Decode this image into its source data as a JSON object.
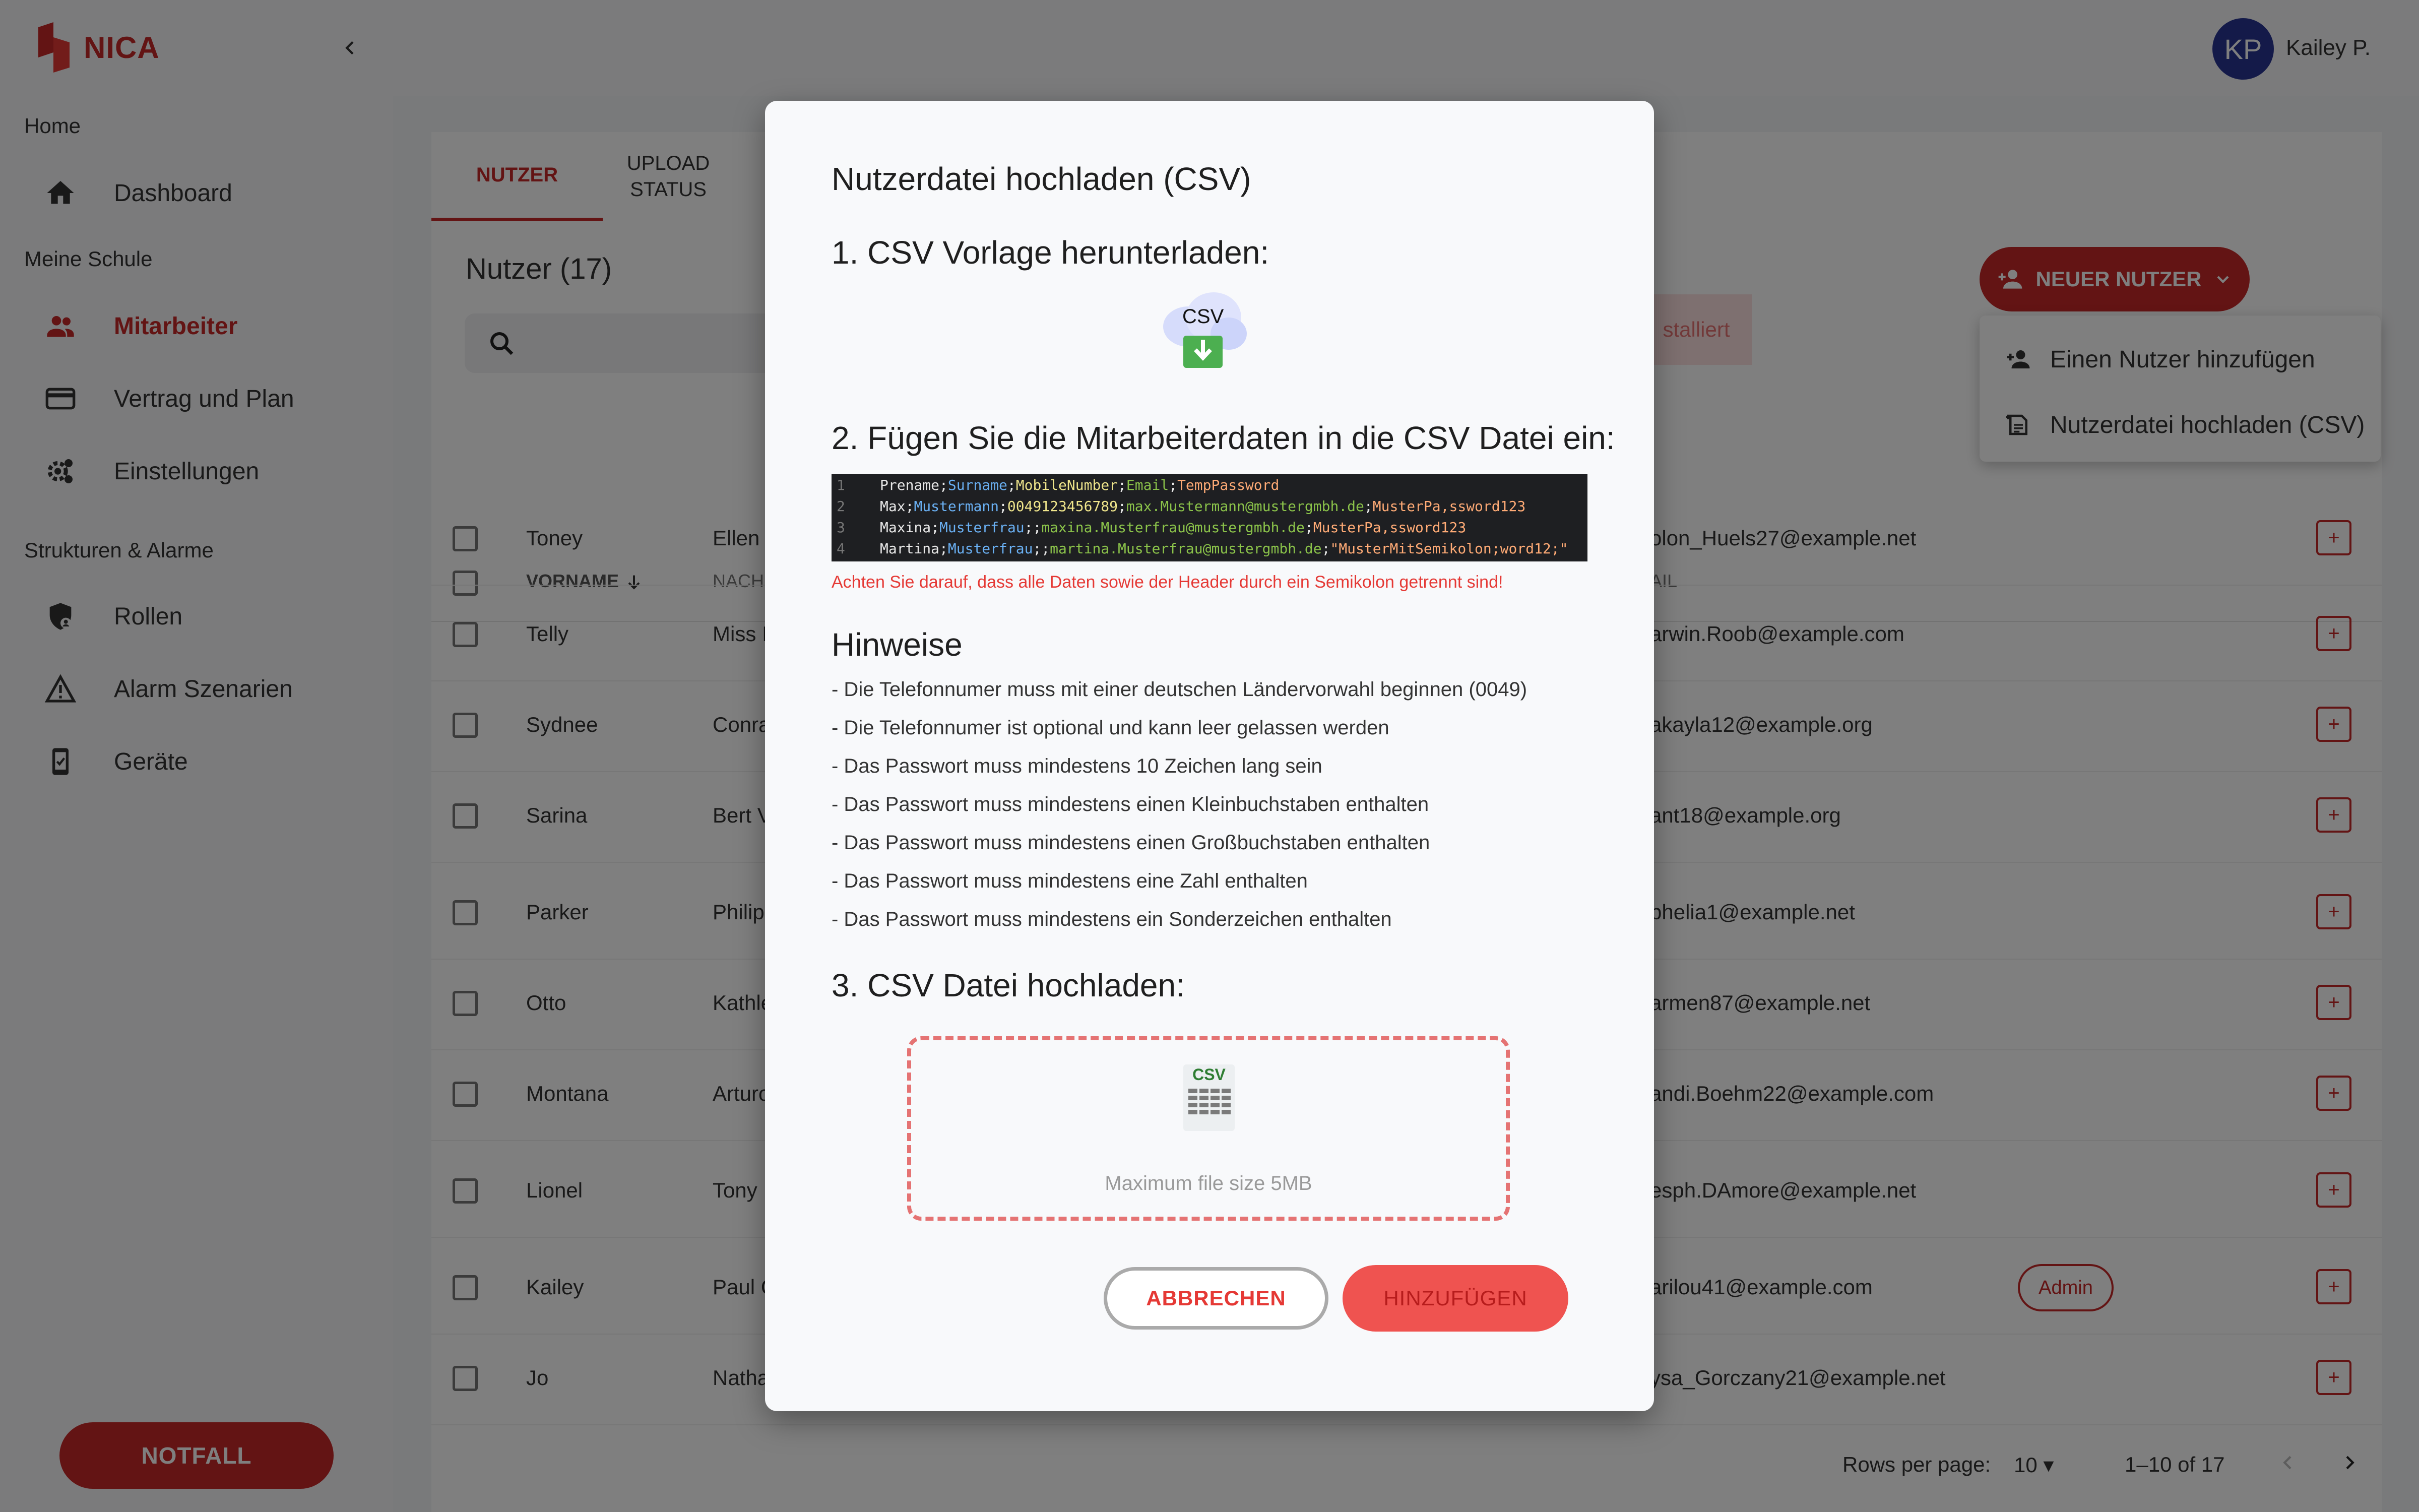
{
  "app": {
    "brand": "NICA"
  },
  "user": {
    "initials": "KP",
    "name": "Kailey P."
  },
  "sidebar": {
    "sections": [
      "Home",
      "Meine Schule",
      "Strukturen & Alarme"
    ],
    "items": [
      {
        "label": "Dashboard",
        "icon": "home-icon"
      },
      {
        "label": "Mitarbeiter",
        "icon": "people-icon",
        "active": true
      },
      {
        "label": "Vertrag und Plan",
        "icon": "credit-card-icon"
      },
      {
        "label": "Einstellungen",
        "icon": "gear-icon"
      },
      {
        "label": "Rollen",
        "icon": "shield-icon"
      },
      {
        "label": "Alarm Szenarien",
        "icon": "warning-icon"
      },
      {
        "label": "Geräte",
        "icon": "device-icon"
      }
    ],
    "emergency_label": "NOTFALL"
  },
  "main": {
    "tabs": [
      {
        "label": "NUTZER",
        "active": true
      },
      {
        "label": "UPLOAD STATUS"
      }
    ],
    "title": "Nutzer (17)",
    "installed_fragment": "stalliert",
    "new_user_button": "NEUER NUTZER",
    "new_user_menu": [
      "Einen Nutzer hinzufügen",
      "Nutzerdatei hochladen (CSV)"
    ],
    "columns": [
      "VORNAME",
      "NACHI",
      "AIL"
    ],
    "rows": [
      {
        "first": "Toney",
        "last": "Ellen",
        "email": "olon_Huels27@example.net"
      },
      {
        "first": "Telly",
        "last": "Miss I",
        "email": "arwin.Roob@example.com"
      },
      {
        "first": "Sydnee",
        "last": "Conra",
        "email": "akayla12@example.org"
      },
      {
        "first": "Sarina",
        "last": "Bert V",
        "email": "ant18@example.org"
      },
      {
        "first": "Parker",
        "last": "Philip",
        "email": "phelia1@example.net"
      },
      {
        "first": "Otto",
        "last": "Kathle",
        "email": "armen87@example.net"
      },
      {
        "first": "Montana",
        "last": "Arturo",
        "email": "andi.Boehm22@example.com"
      },
      {
        "first": "Lionel",
        "last": "Tony I",
        "email": "esph.DAmore@example.net"
      },
      {
        "first": "Kailey",
        "last": "Paul C",
        "email": "arilou41@example.com",
        "role": "Admin"
      },
      {
        "first": "Jo",
        "last": "Natha",
        "email": "ysa_Gorczany21@example.net"
      }
    ],
    "pagination": {
      "rows_per_page_label": "Rows per page:",
      "rows_per_page": "10",
      "range": "1–10 of 17"
    }
  },
  "modal": {
    "title": "Nutzerdatei hochladen (CSV)",
    "step1": "1. CSV Vorlage herunterladen:",
    "csv_icon_label": "CSV",
    "step2": "2. Fügen Sie die Mitarbeiterdaten in die CSV Datei ein:",
    "code_lines": [
      {
        "n": "1",
        "prename": "Prename",
        "surname": "Surname",
        "mobile": "MobileNumber",
        "email": "Email",
        "pw": "TempPassword"
      },
      {
        "n": "2",
        "prename": "Max",
        "surname": "Mustermann",
        "mobile": "0049123456789",
        "email": "max.Mustermann@mustergmbh.de",
        "pw": "MusterPa,ssword123"
      },
      {
        "n": "3",
        "prename": "Maxina",
        "surname": "Musterfrau",
        "mobile": "",
        "email": "maxina.Musterfrau@mustergmbh.de",
        "pw": "MusterPa,ssword123"
      },
      {
        "n": "4",
        "prename": "Martina",
        "surname": "Musterfrau",
        "mobile": "",
        "email": "martina.Musterfrau@mustergmbh.de",
        "pw": "\"MusterMitSemikolon;word12;\""
      }
    ],
    "warning": "Achten Sie darauf, dass alle Daten sowie der Header durch ein Semikolon getrennt sind!",
    "hints_title": "Hinweise",
    "hints": [
      "- Die Telefonnumer muss mit einer deutschen Ländervorwahl beginnen (0049)",
      "- Die Telefonnumer ist optional und kann leer gelassen werden",
      "- Das Passwort muss mindestens 10 Zeichen lang sein",
      "- Das Passwort muss mindestens einen Kleinbuchstaben enthalten",
      "- Das Passwort muss mindestens einen Großbuchstaben enthalten",
      "- Das Passwort muss mindestens eine Zahl enthalten",
      "- Das Passwort muss mindestens ein Sonderzeichen enthalten"
    ],
    "step3": "3. CSV Datei hochladen:",
    "dropzone_icon_label": "CSV",
    "dropzone_text": "Maximum file size 5MB",
    "cancel_label": "ABBRECHEN",
    "submit_label": "HINZUFÜGEN"
  },
  "colors": {
    "brand": "#c62828",
    "overlay": "rgba(0,0,0,0.5)",
    "code_bg": "#1e1f22"
  }
}
